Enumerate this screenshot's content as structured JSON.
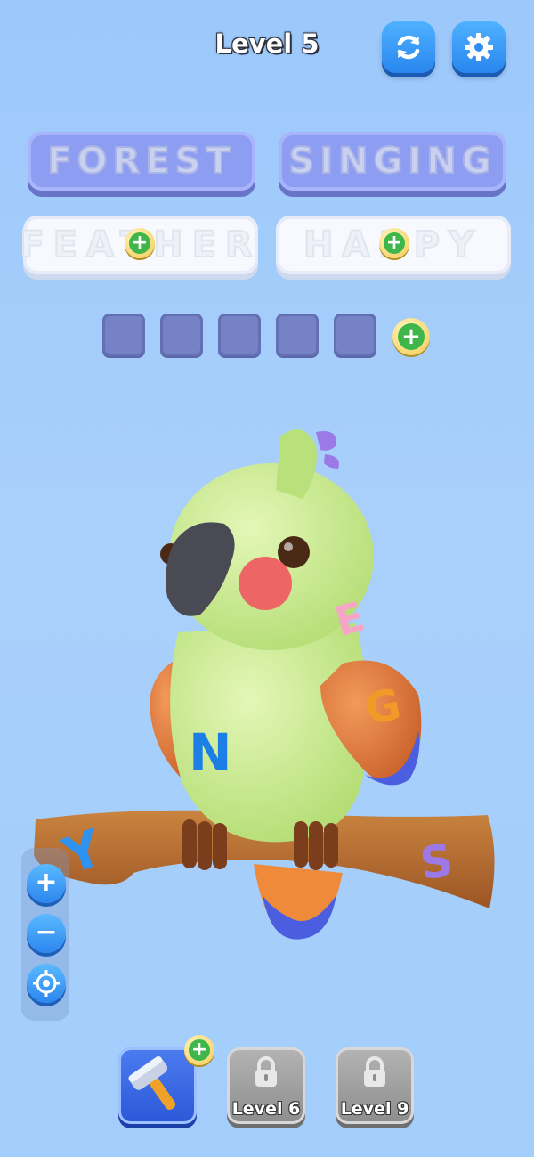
{
  "header": {
    "title": "Level 5"
  },
  "icons": {
    "restart": "refresh-icon",
    "settings": "gear-icon"
  },
  "words": [
    {
      "text": "FOREST",
      "state": "found"
    },
    {
      "text": "SINGING",
      "state": "found"
    },
    {
      "text": "FEATHER",
      "state": "hidden"
    },
    {
      "text": "HAPPY",
      "state": "hidden"
    }
  ],
  "letter_slots": {
    "count": 5
  },
  "model_letters": [
    "E",
    "G",
    "N",
    "Y",
    "S"
  ],
  "zoom": {
    "in": "+",
    "out": "−"
  },
  "bottom_bar": {
    "hammer": {
      "icon": "hammer-icon"
    },
    "levels": [
      {
        "label": "Level 6"
      },
      {
        "label": "Level 9"
      }
    ]
  },
  "colors": {
    "accent": "#2f8cf0",
    "parrot_body": "#c7eb8d",
    "wing": "#e27a3a",
    "branch": "#b86a2f"
  }
}
